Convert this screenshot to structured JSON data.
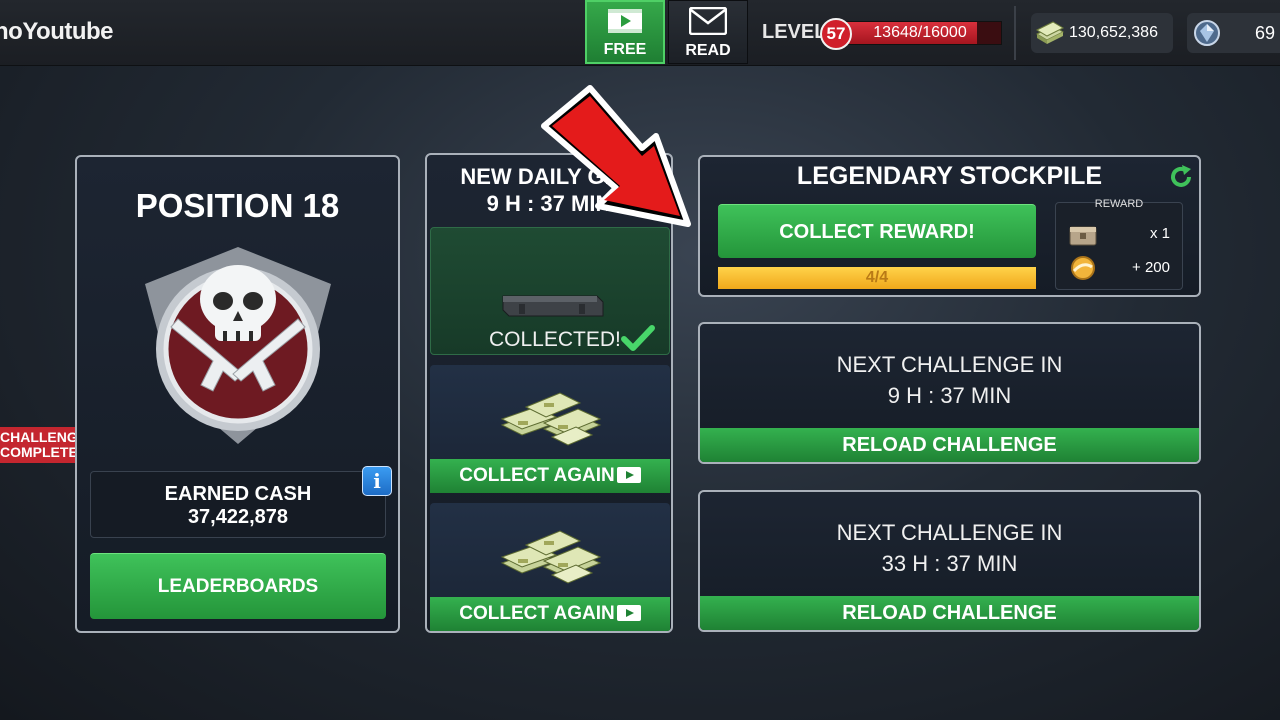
{
  "header": {
    "player_name": "noYoutube",
    "free_label": "FREE",
    "read_label": "READ",
    "level_label": "LEVEL",
    "level": "57",
    "xp": "13648/16000",
    "xp_fraction": 0.853,
    "cash": "130,652,386",
    "gems": "69"
  },
  "position_panel": {
    "title": "POSITION 18",
    "earned_label": "EARNED CASH",
    "earned_value": "37,422,878",
    "leaderboards_label": "LEADERBOARDS",
    "info_label": "i"
  },
  "challenge_ribbon": {
    "line1": "CHALLENGE",
    "line2": "COMPLETED"
  },
  "daily_gift": {
    "title": "NEW DAILY GIFT",
    "timer": "9 H : 37 MIN",
    "collected_label": "COLLECTED!",
    "collect_again_1": "COLLECT AGAIN",
    "collect_again_2": "COLLECT AGAIN"
  },
  "stockpile": {
    "title": "LEGENDARY STOCKPILE",
    "collect_label": "COLLECT REWARD!",
    "progress_text": "4/4",
    "progress_fraction": 1.0,
    "reward_label": "REWARD",
    "reward_item_qty": "x 1",
    "reward_gold_qty": "+ 200"
  },
  "next_challenges": [
    {
      "label": "NEXT CHALLENGE IN",
      "timer": "9 H : 37 MIN",
      "button": "RELOAD CHALLENGE"
    },
    {
      "label": "NEXT CHALLENGE IN",
      "timer": "33 H : 37 MIN",
      "button": "RELOAD CHALLENGE"
    }
  ],
  "colors": {
    "accent_green": "#2fa446",
    "level_red": "#d01f2b",
    "progress_gold": "#f0a81b",
    "arrow_red": "#e41b1b"
  }
}
